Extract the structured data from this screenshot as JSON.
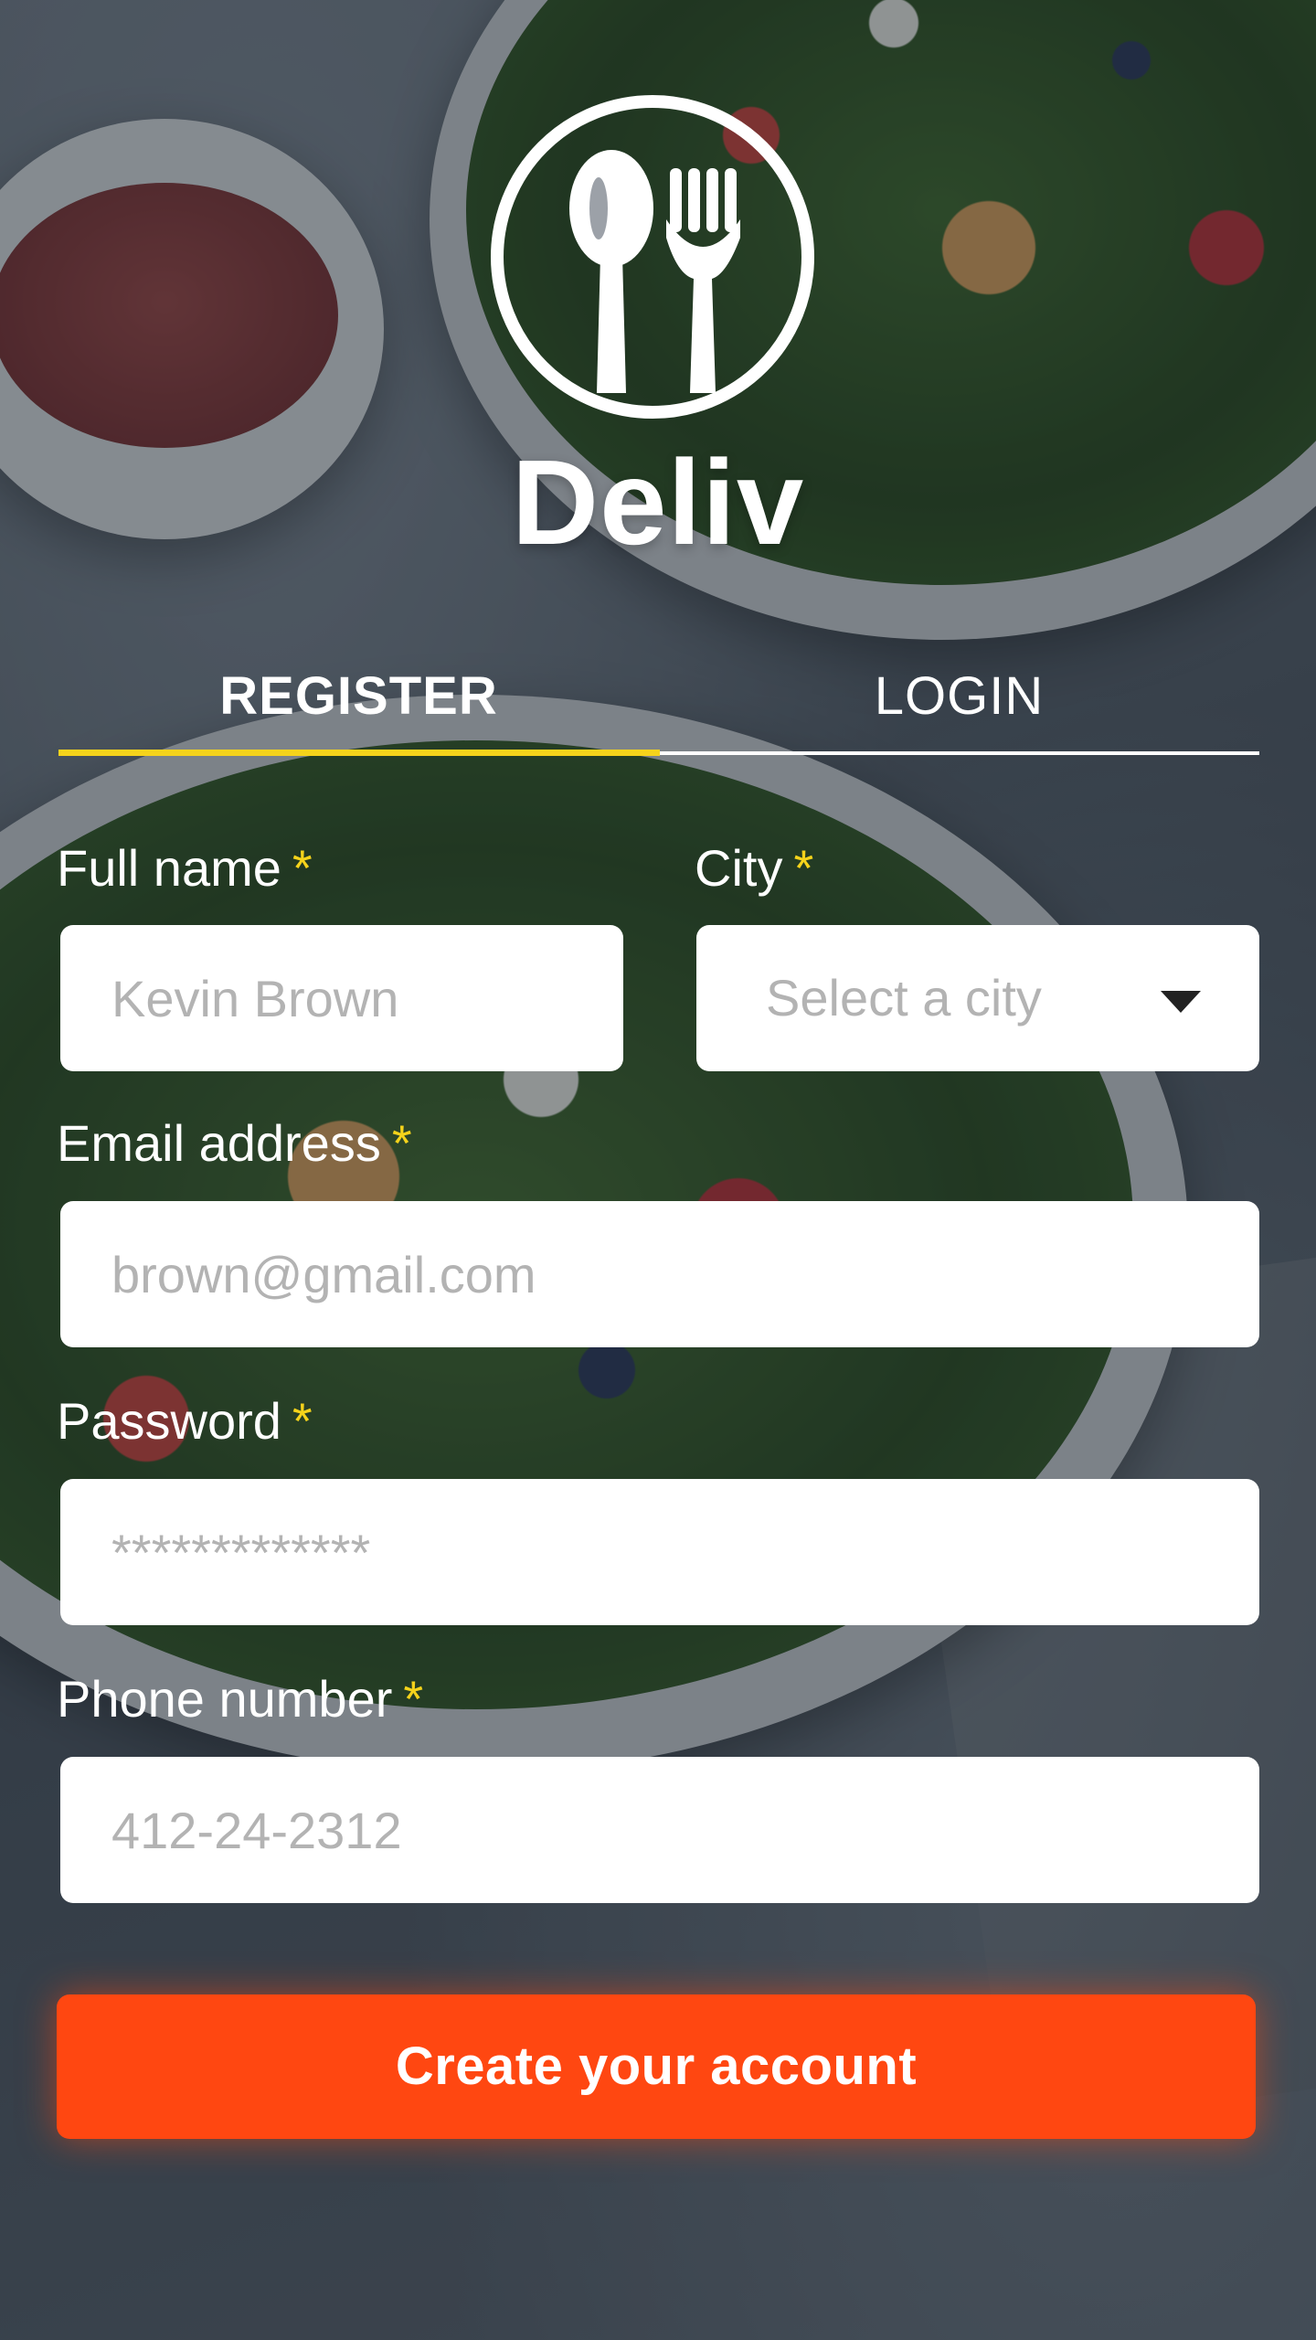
{
  "app": {
    "brand": "Deliv",
    "logo_icon": "spoon-fork-icon"
  },
  "tabs": [
    {
      "label": "REGISTER",
      "active": true
    },
    {
      "label": "LOGIN",
      "active": false
    }
  ],
  "form": {
    "required_mark": "*",
    "full_name": {
      "label": "Full name",
      "placeholder": "Kevin Brown"
    },
    "city": {
      "label": "City",
      "placeholder": "Select a city"
    },
    "email": {
      "label": "Email address",
      "placeholder": "brown@gmail.com"
    },
    "password": {
      "label": "Password",
      "placeholder": "*************"
    },
    "phone": {
      "label": "Phone number",
      "placeholder": "412-24-2312"
    },
    "submit_label": "Create your account"
  },
  "colors": {
    "accent_yellow": "#f5d31b",
    "cta_orange": "#ff4711",
    "field_bg": "#ffffff",
    "placeholder": "#b3b3b3"
  }
}
